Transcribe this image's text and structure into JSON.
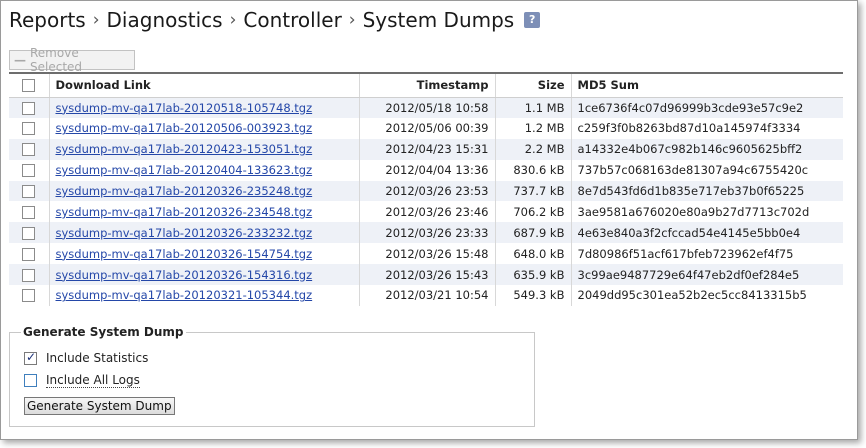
{
  "breadcrumb": [
    "Reports",
    "Diagnostics",
    "Controller",
    "System Dumps"
  ],
  "help_icon": "?",
  "remove_button": {
    "label": "Remove Selected",
    "state": "disabled"
  },
  "table": {
    "columns": [
      "",
      "Download Link",
      "Timestamp",
      "Size",
      "MD5 Sum"
    ],
    "rows": [
      {
        "link": "sysdump-mv-qa17lab-20120518-105748.tgz",
        "timestamp": "2012/05/18 10:58",
        "size": "1.1 MB",
        "md5": "1ce6736f4c07d96999b3cde93e57c9e2"
      },
      {
        "link": "sysdump-mv-qa17lab-20120506-003923.tgz",
        "timestamp": "2012/05/06 00:39",
        "size": "1.2 MB",
        "md5": "c259f3f0b8263bd87d10a145974f3334"
      },
      {
        "link": "sysdump-mv-qa17lab-20120423-153051.tgz",
        "timestamp": "2012/04/23 15:31",
        "size": "2.2 MB",
        "md5": "a14332e4b067c982b146c9605625bff2"
      },
      {
        "link": "sysdump-mv-qa17lab-20120404-133623.tgz",
        "timestamp": "2012/04/04 13:36",
        "size": "830.6 kB",
        "md5": "737b57c068163de81307a94c6755420c"
      },
      {
        "link": "sysdump-mv-qa17lab-20120326-235248.tgz",
        "timestamp": "2012/03/26 23:53",
        "size": "737.7 kB",
        "md5": "8e7d543fd6d1b835e717eb37b0f65225"
      },
      {
        "link": "sysdump-mv-qa17lab-20120326-234548.tgz",
        "timestamp": "2012/03/26 23:46",
        "size": "706.2 kB",
        "md5": "3ae9581a676020e80a9b27d7713c702d"
      },
      {
        "link": "sysdump-mv-qa17lab-20120326-233232.tgz",
        "timestamp": "2012/03/26 23:33",
        "size": "687.9 kB",
        "md5": "4e63e840a3f2cfccad54e4145e5bb0e4"
      },
      {
        "link": "sysdump-mv-qa17lab-20120326-154754.tgz",
        "timestamp": "2012/03/26 15:48",
        "size": "648.0 kB",
        "md5": "7d80986f51acf617bfeb723962ef4f75"
      },
      {
        "link": "sysdump-mv-qa17lab-20120326-154316.tgz",
        "timestamp": "2012/03/26 15:43",
        "size": "635.9 kB",
        "md5": "3c99ae9487729e64f47eb2df0ef284e5"
      },
      {
        "link": "sysdump-mv-qa17lab-20120321-105344.tgz",
        "timestamp": "2012/03/21 10:54",
        "size": "549.3 kB",
        "md5": "2049dd95c301ea52b2ec5cc8413315b5"
      }
    ]
  },
  "generate": {
    "title": "Generate System Dump",
    "include_statistics": {
      "label": "Include Statistics",
      "checked": true
    },
    "include_all_logs": {
      "label": "Include All Logs",
      "checked": false
    },
    "button_label": "Generate System Dump"
  },
  "colors": {
    "link": "#2447a8",
    "row_stripe": "#eef1f7",
    "help_icon_bg": "#7d8fb7"
  }
}
